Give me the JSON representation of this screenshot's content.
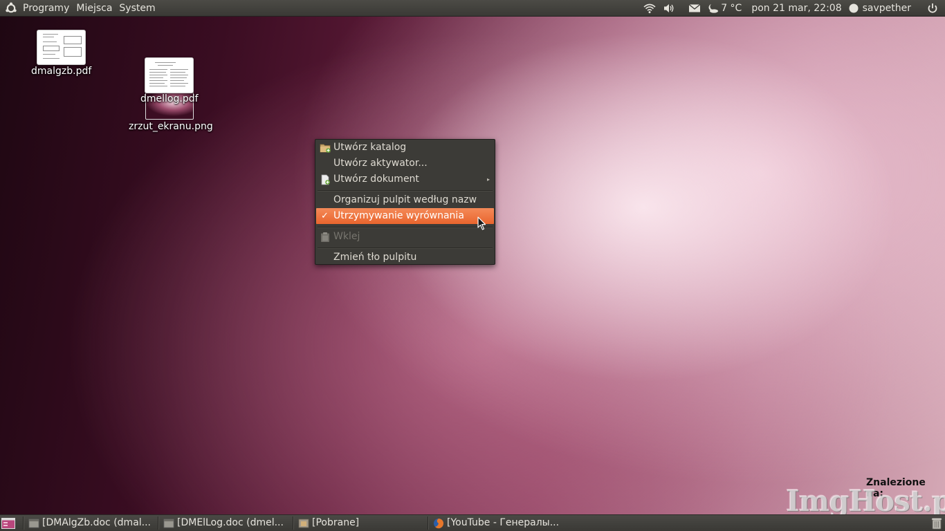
{
  "top_panel": {
    "menus": [
      "Programy",
      "Miejsca",
      "System"
    ],
    "weather": "7 °C",
    "clock": "pon 21 mar, 22:08",
    "user": "savpether"
  },
  "desktop": {
    "icons": [
      {
        "label": "dmalgzb.pdf"
      },
      {
        "label": "dmellog.pdf"
      },
      {
        "label": "zrzut_ekranu.png"
      }
    ]
  },
  "context_menu": {
    "items": [
      {
        "label": "Utwórz katalog",
        "icon": "folder-new-icon"
      },
      {
        "label": "Utwórz aktywator..."
      },
      {
        "label": "Utwórz dokument",
        "icon": "document-new-icon",
        "submenu": "▸"
      },
      {
        "label": "Organizuj pulpit według nazw"
      },
      {
        "label": "Utrzymywanie wyrównania",
        "check": "✓",
        "highlighted": true
      },
      {
        "label": "Wklej",
        "icon": "paste-icon",
        "disabled": true
      },
      {
        "label": "Zmień tło pulpitu"
      }
    ]
  },
  "watermark": {
    "found_text": "Znalezione na:",
    "logo": "ImgHost.pl"
  },
  "taskbar": {
    "tasks": [
      {
        "label": "[DMAlgZb.doc (dmal...",
        "icon": "document-window-icon"
      },
      {
        "label": "[DMElLog.doc (dmel...",
        "icon": "document-window-icon"
      },
      {
        "label": "[Pobrane]",
        "icon": "folder-window-icon"
      },
      {
        "label": "[YouTube - Генералы...",
        "icon": "firefox-icon"
      }
    ]
  },
  "colors": {
    "highlight": "#e9652e",
    "menu_bg": "#3c3b37",
    "panel_bg": "#3c3b37"
  }
}
